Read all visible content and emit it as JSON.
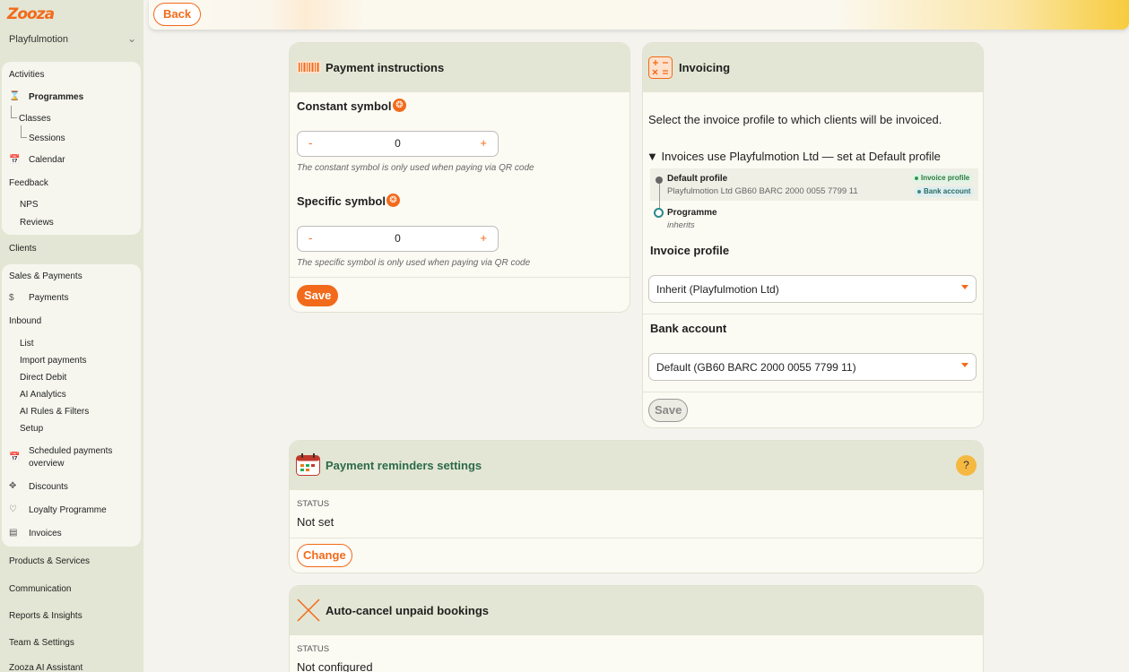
{
  "app": {
    "logo": "Zooza",
    "org_name": "Playfulmotion"
  },
  "sidebar": {
    "activities_group": {
      "heading": "Activities",
      "programmes": "Programmes",
      "classes": "Classes",
      "sessions": "Sessions",
      "calendar": "Calendar",
      "feedback": "Feedback",
      "nps": "NPS",
      "reviews": "Reviews"
    },
    "clients": "Clients",
    "sales_group": {
      "heading": "Sales & Payments",
      "payments": "Payments",
      "inbound": "Inbound",
      "list": "List",
      "import_payments": "Import payments",
      "direct_debit": "Direct Debit",
      "ai_analytics": "AI Analytics",
      "ai_rules": "AI Rules & Filters",
      "setup": "Setup",
      "scheduled_line1": "Scheduled payments",
      "scheduled_line2": "overview",
      "discounts": "Discounts",
      "loyalty": "Loyalty Programme",
      "invoices": "Invoices"
    },
    "products_services": "Products & Services",
    "communication": "Communication",
    "reports": "Reports & Insights",
    "team_settings": "Team & Settings",
    "ai_assistant": "Zooza AI Assistant"
  },
  "topbar": {
    "back_label": "Back"
  },
  "payment_instructions": {
    "title": "Payment instructions",
    "constant_label": "Constant symbol",
    "constant_value": "0",
    "constant_hint": "The constant symbol is only used when paying via QR code",
    "specific_label": "Specific symbol",
    "specific_value": "0",
    "specific_hint": "The specific symbol is only used when paying via QR code",
    "save_label": "Save",
    "minus": "-",
    "plus": "+"
  },
  "invoicing": {
    "title": "Invoicing",
    "description": "Select the invoice profile to which clients will be invoiced.",
    "summary": "▼ Invoices use Playfulmotion Ltd — set at Default profile",
    "default_profile": "Default profile",
    "default_profile_detail": "Playfulmotion Ltd GB60 BARC 2000 0055 7799 11",
    "badge_invoice_profile": "Invoice profile",
    "badge_bank_account": "Bank account",
    "programme": "Programme",
    "programme_detail": "inherits",
    "invoice_profile_label": "Invoice profile",
    "invoice_profile_value": "Inherit (Playfulmotion Ltd)",
    "bank_account_label": "Bank account",
    "bank_account_value": "Default (GB60 BARC 2000 0055 7799 11)",
    "save_label": "Save"
  },
  "reminders": {
    "title": "Payment reminders settings",
    "status_label": "STATUS",
    "status_value": "Not set",
    "change_label": "Change",
    "help": "?"
  },
  "autocancel": {
    "title": "Auto-cancel unpaid bookings",
    "status_label": "STATUS",
    "status_value": "Not configured"
  },
  "colors": {
    "accent": "#f26a1b",
    "sidebar_bg": "#e3e6d4",
    "card_bg": "#fbfaf3",
    "help_bg": "#f5b942"
  }
}
